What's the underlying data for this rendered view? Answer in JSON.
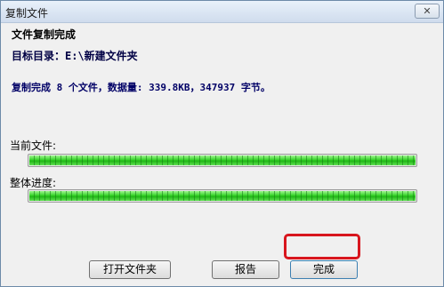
{
  "window": {
    "title": "复制文件",
    "close_glyph": "✕"
  },
  "content": {
    "heading": "文件复制完成",
    "target_dir": "目标目录：E:\\新建文件夹",
    "summary": "复制完成 8 个文件，数据量: 339.8KB，347937 字节。"
  },
  "progress": {
    "current_label": "当前文件:",
    "current_fraction": 1.0,
    "overall_label": "整体进度:",
    "overall_fraction": 1.0,
    "fill_color": "#37d32a"
  },
  "buttons": {
    "open_folder": "打开文件夹",
    "report": "报告",
    "done": "完成"
  },
  "highlight": {
    "color": "#d8161e"
  }
}
